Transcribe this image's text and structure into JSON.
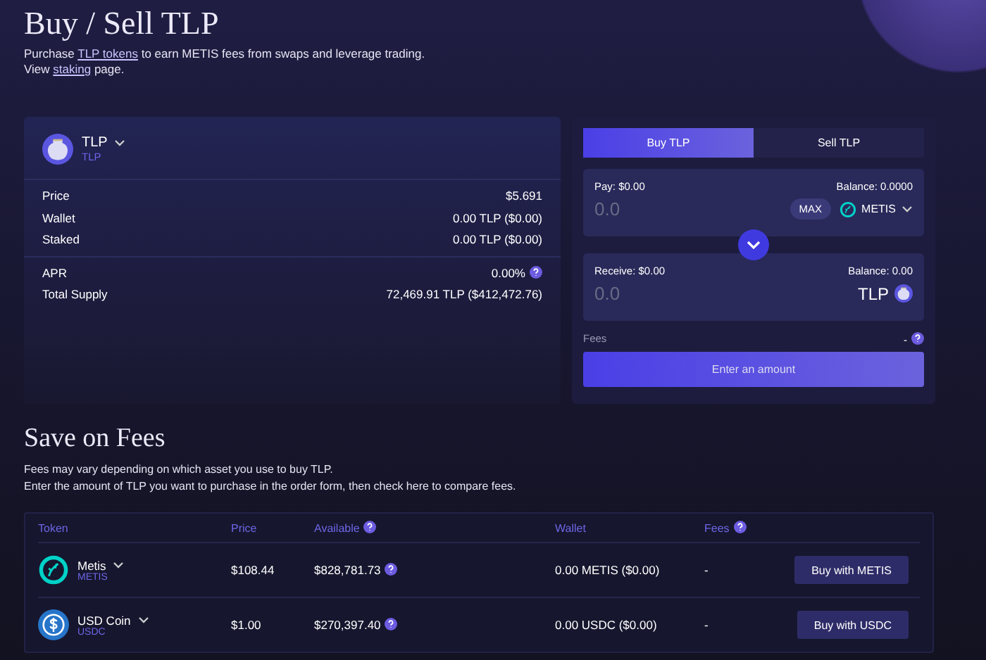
{
  "header": {
    "title": "Buy / Sell TLP",
    "lines": [
      {
        "before": "Purchase ",
        "link": "TLP tokens",
        "after": " to earn METIS fees from swaps and leverage trading."
      },
      {
        "before": "View ",
        "link": "staking",
        "after": " page."
      }
    ]
  },
  "token_card": {
    "symbol": "TLP",
    "subtitle": "TLP",
    "stat_groups": [
      [
        {
          "label": "Price",
          "value": "$5.691",
          "info": false
        },
        {
          "label": "Wallet",
          "value": "0.00 TLP ($0.00)",
          "info": false
        },
        {
          "label": "Staked",
          "value": "0.00 TLP ($0.00)",
          "info": false
        }
      ],
      [
        {
          "label": "APR",
          "value": "0.00%",
          "info": true
        },
        {
          "label": "Total Supply",
          "value": "72,469.91 TLP ($412,472.76)",
          "info": false
        }
      ]
    ]
  },
  "swap": {
    "tabs": [
      {
        "label": "Buy TLP",
        "selected": true
      },
      {
        "label": "Sell TLP",
        "selected": false
      }
    ],
    "pay": {
      "label": "Pay: $0.00",
      "balance": "Balance: 0.0000",
      "placeholder": "0.0",
      "max": "MAX",
      "token": "METIS",
      "kind": "metis"
    },
    "receive": {
      "label": "Receive: $0.00",
      "balance": "Balance: 0.00",
      "placeholder": "0.0",
      "token": "TLP",
      "kind": "tlp"
    },
    "fees": {
      "label": "Fees",
      "value": "-"
    },
    "submit": "Enter an amount"
  },
  "save": {
    "title": "Save on Fees",
    "lines": [
      "Fees may vary depending on which asset you use to buy TLP.",
      "Enter the amount of TLP you want to purchase in the order form, then check here to compare fees."
    ],
    "columns": [
      {
        "label": "Token",
        "info": false
      },
      {
        "label": "Price",
        "info": false
      },
      {
        "label": "Available",
        "info": true
      },
      {
        "label": "Wallet",
        "info": false
      },
      {
        "label": "Fees",
        "info": true
      }
    ],
    "rows": [
      {
        "name": "Metis",
        "symbol": "METIS",
        "kind": "metis",
        "price": "$108.44",
        "available": "$828,781.73",
        "wallet": "0.00 METIS ($0.00)",
        "fees": "-",
        "action": "Buy with METIS"
      },
      {
        "name": "USD Coin",
        "symbol": "USDC",
        "kind": "usdc",
        "price": "$1.00",
        "available": "$270,397.40",
        "wallet": "0.00 USDC ($0.00)",
        "fees": "-",
        "action": "Buy with USDC"
      }
    ]
  }
}
